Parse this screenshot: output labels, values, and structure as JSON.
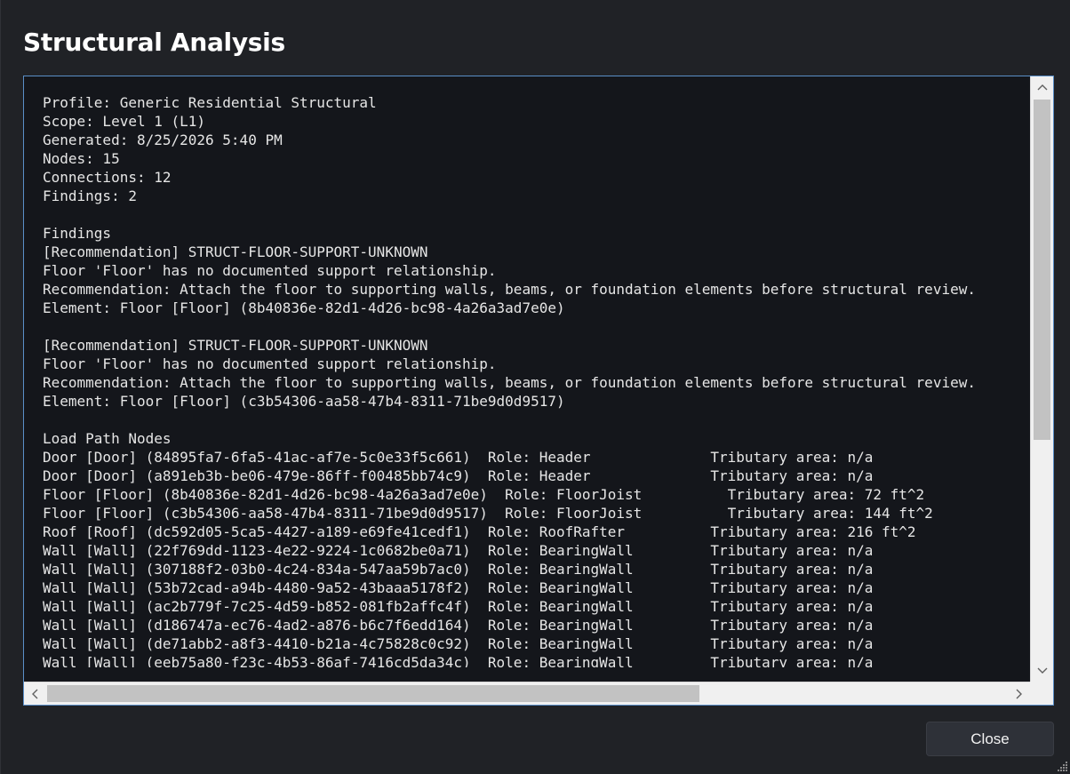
{
  "window": {
    "title": "Structural Analysis"
  },
  "report": {
    "lines": [
      "Profile: Generic Residential Structural",
      "Scope: Level 1 (L1)",
      "Generated: 8/25/2026 5:40 PM",
      "Nodes: 15",
      "Connections: 12",
      "Findings: 2",
      "",
      "Findings",
      "[Recommendation] STRUCT-FLOOR-SUPPORT-UNKNOWN",
      "Floor 'Floor' has no documented support relationship.",
      "Recommendation: Attach the floor to supporting walls, beams, or foundation elements before structural review.",
      "Element: Floor [Floor] (8b40836e-82d1-4d26-bc98-4a26a3ad7e0e)",
      "",
      "[Recommendation] STRUCT-FLOOR-SUPPORT-UNKNOWN",
      "Floor 'Floor' has no documented support relationship.",
      "Recommendation: Attach the floor to supporting walls, beams, or foundation elements before structural review.",
      "Element: Floor [Floor] (c3b54306-aa58-47b4-8311-71be9d0d9517)",
      "",
      "Load Path Nodes",
      "Door [Door] (84895fa7-6fa5-41ac-af7e-5c0e33f5c661)  Role: Header              Tributary area: n/a",
      "Door [Door] (a891eb3b-be06-479e-86ff-f00485bb74c9)  Role: Header              Tributary area: n/a",
      "Floor [Floor] (8b40836e-82d1-4d26-bc98-4a26a3ad7e0e)  Role: FloorJoist          Tributary area: 72 ft^2",
      "Floor [Floor] (c3b54306-aa58-47b4-8311-71be9d0d9517)  Role: FloorJoist          Tributary area: 144 ft^2",
      "Roof [Roof] (dc592d05-5ca5-4427-a189-e69fe41cedf1)  Role: RoofRafter          Tributary area: 216 ft^2",
      "Wall [Wall] (22f769dd-1123-4e22-9224-1c0682be0a71)  Role: BearingWall         Tributary area: n/a",
      "Wall [Wall] (307188f2-03b0-4c24-834a-547aa59b7ac0)  Role: BearingWall         Tributary area: n/a",
      "Wall [Wall] (53b72cad-a94b-4480-9a52-43baaa5178f2)  Role: BearingWall         Tributary area: n/a",
      "Wall [Wall] (ac2b779f-7c25-4d59-b852-081fb2affc4f)  Role: BearingWall         Tributary area: n/a",
      "Wall [Wall] (d186747a-ec76-4ad2-a876-b6c7f6edd164)  Role: BearingWall         Tributary area: n/a",
      "Wall [Wall] (de71abb2-a8f3-4410-b21a-4c75828c0c92)  Role: BearingWall         Tributary area: n/a",
      "Wall [Wall] (eeb75a80-f23c-4b53-86af-7416cd5da34c)  Role: BearingWall         Tributary area: n/a"
    ]
  },
  "icons": {
    "scroll_up": "chevron-up-icon",
    "scroll_down": "chevron-down-icon",
    "scroll_left": "chevron-left-icon",
    "scroll_right": "chevron-right-icon",
    "resize": "resize-grip-icon"
  },
  "buttons": {
    "close_label": "Close"
  },
  "colors": {
    "background": "#202226",
    "text_area": "#14161b",
    "text": "#e6e6e6",
    "focus_border": "#5a8ec7"
  }
}
